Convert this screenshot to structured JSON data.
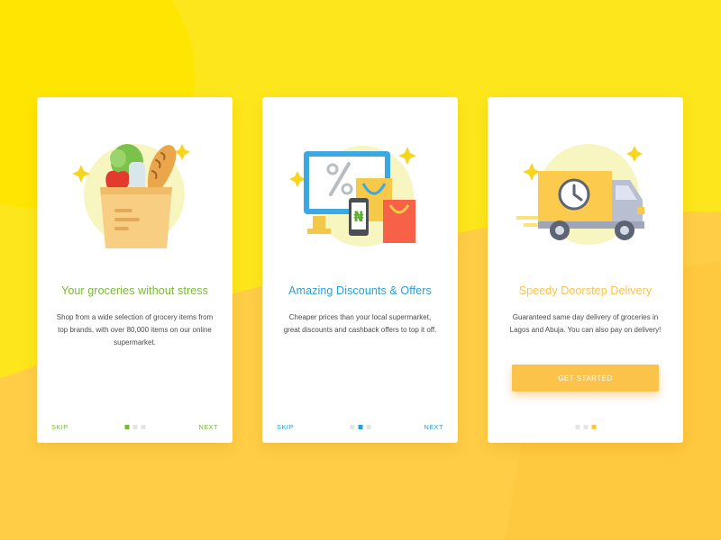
{
  "colors": {
    "background_yellow": "#FDE71C",
    "background_orange": "#FFCE46",
    "accent_green": "#7AB83A",
    "accent_blue": "#2A9FD8",
    "accent_orange": "#FCC34B",
    "dot_inactive": "#E4E4E4"
  },
  "cards": [
    {
      "illustration": "grocery-bag-icon",
      "title": "Your groceries without stress",
      "body": "Shop from a wide selection of grocery items from top brands, with over 80,000 items on our online supermarket.",
      "skip_label": "SKIP",
      "next_label": "NEXT",
      "active_page": 1,
      "page_count": 3,
      "accent": "#7AB83A"
    },
    {
      "illustration": "discount-monitor-icon",
      "title": "Amazing Discounts & Offers",
      "body": "Cheaper prices than your local supermarket, great discounts and cashback offers to top it off.",
      "skip_label": "SKIP",
      "next_label": "NEXT",
      "active_page": 2,
      "page_count": 3,
      "accent": "#2A9FD8",
      "currency_symbol": "₦"
    },
    {
      "illustration": "delivery-truck-icon",
      "title": "Speedy Doorstep Delivery",
      "body": "Guaranteed same day delivery of groceries in Lagos and Abuja. You can also pay on delivery!",
      "button_label": "GET STARTED",
      "active_page": 3,
      "page_count": 3,
      "accent": "#FCC34B"
    }
  ]
}
